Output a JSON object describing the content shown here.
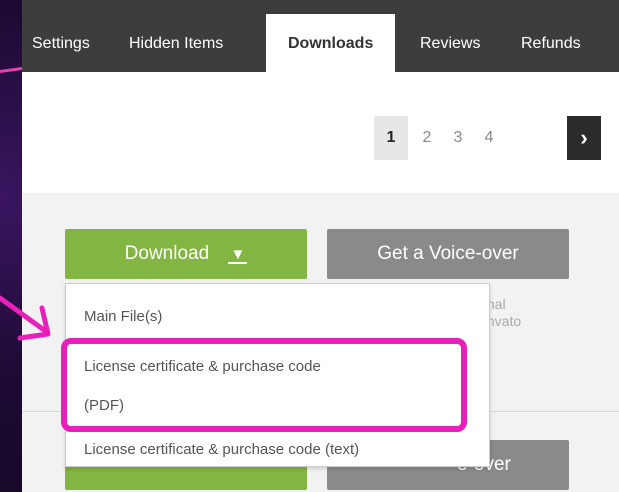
{
  "tabs": [
    {
      "label": "Settings"
    },
    {
      "label": "Hidden Items"
    },
    {
      "label": "Downloads",
      "active": true
    },
    {
      "label": "Reviews"
    },
    {
      "label": "Refunds"
    }
  ],
  "pagination": {
    "pages": [
      "1",
      "2",
      "3",
      "4"
    ],
    "current": "1",
    "next_label": "›"
  },
  "item": {
    "download_button": "Download",
    "download_caret": "▼",
    "voiceover_button": "Get a Voice-over",
    "voiceover_desc": "ssional\nm Envato\n."
  },
  "dropdown": {
    "items": [
      "Main File(s)",
      "License certificate & purchase code",
      "(PDF)",
      "License certificate & purchase code (text)"
    ]
  },
  "item2": {
    "voiceover_button_partial": "e-over"
  },
  "colors": {
    "accent_highlight": "#e81fb8",
    "download_green": "#82b541",
    "tabbar": "#3d3d3d"
  }
}
